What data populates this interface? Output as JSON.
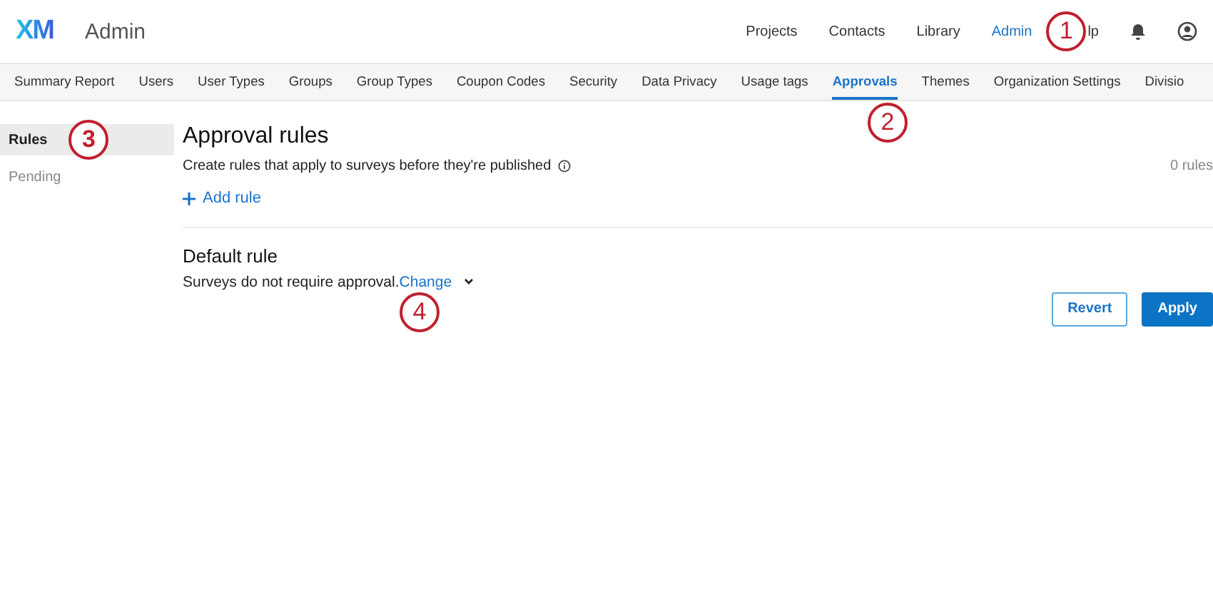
{
  "header": {
    "logo": "XM",
    "title": "Admin",
    "nav": [
      {
        "label": "Projects",
        "selected": false
      },
      {
        "label": "Contacts",
        "selected": false
      },
      {
        "label": "Library",
        "selected": false
      },
      {
        "label": "Admin",
        "selected": true
      },
      {
        "label": "lp",
        "selected": false
      }
    ]
  },
  "tabs": [
    {
      "label": "Summary Report",
      "selected": false
    },
    {
      "label": "Users",
      "selected": false
    },
    {
      "label": "User Types",
      "selected": false
    },
    {
      "label": "Groups",
      "selected": false
    },
    {
      "label": "Group Types",
      "selected": false
    },
    {
      "label": "Coupon Codes",
      "selected": false
    },
    {
      "label": "Security",
      "selected": false
    },
    {
      "label": "Data Privacy",
      "selected": false
    },
    {
      "label": "Usage tags",
      "selected": false
    },
    {
      "label": "Approvals",
      "selected": true
    },
    {
      "label": "Themes",
      "selected": false
    },
    {
      "label": "Organization Settings",
      "selected": false
    },
    {
      "label": "Divisio",
      "selected": false
    }
  ],
  "sidebar": {
    "items": [
      {
        "label": "Rules",
        "selected": true
      },
      {
        "label": "Pending",
        "selected": false
      }
    ]
  },
  "main": {
    "title": "Approval rules",
    "subtitle": "Create rules that apply to surveys before they're published",
    "count": "0 rules",
    "add_rule": "Add rule",
    "default_title": "Default rule",
    "default_text": "Surveys do not require approval.",
    "change": "Change",
    "buttons": [
      "Revert",
      "Apply"
    ]
  },
  "callouts": [
    "1",
    "2",
    "3",
    "4"
  ]
}
